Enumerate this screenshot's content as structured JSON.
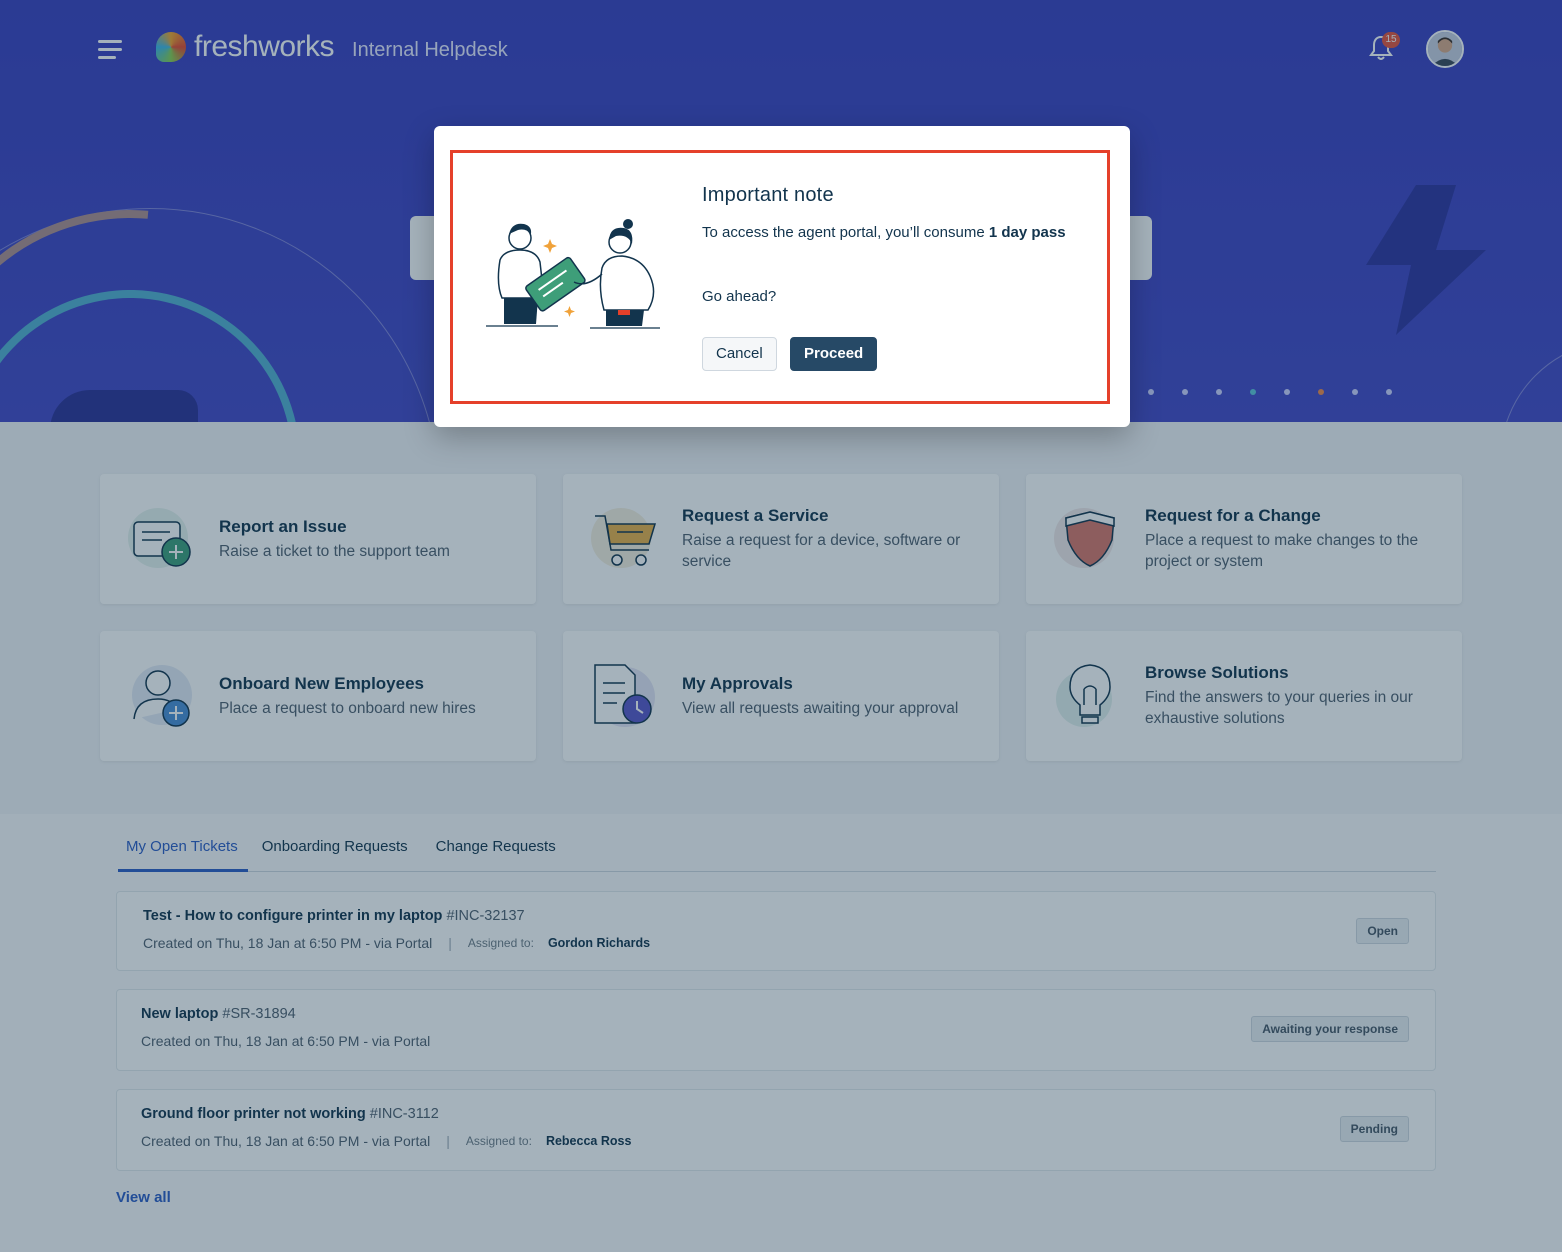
{
  "header": {
    "logo_text": "freshworks",
    "portal_name": "Internal Helpdesk",
    "notification_count": "15"
  },
  "cards": [
    {
      "title": "Report an Issue",
      "desc": "Raise a ticket to the support team",
      "icon": "ticket-plus-icon"
    },
    {
      "title": "Request a Service",
      "desc": "Raise a request for a device, software or service",
      "icon": "shopping-cart-icon"
    },
    {
      "title": "Request for a Change",
      "desc": "Place a request to make changes to the project or system",
      "icon": "shield-icon"
    },
    {
      "title": "Onboard New Employees",
      "desc": "Place a request to onboard new hires",
      "icon": "user-plus-icon"
    },
    {
      "title": "My Approvals",
      "desc": "View all requests awaiting your approval",
      "icon": "document-clock-icon"
    },
    {
      "title": "Browse Solutions",
      "desc": "Find the answers to your queries in our exhaustive solutions",
      "icon": "lightbulb-icon"
    }
  ],
  "tabs": [
    {
      "label": "My Open Tickets",
      "active": true
    },
    {
      "label": "Onboarding Requests",
      "active": false
    },
    {
      "label": "Change Requests",
      "active": false
    }
  ],
  "tickets": [
    {
      "title": "Test - How to configure printer in my laptop",
      "id": "#INC-32137",
      "created": "Created on Thu, 18 Jan at 6:50 PM - via Portal",
      "sep": "|",
      "assigned_label": "Assigned to:",
      "assignee": "Gordon Richards",
      "status": "Open"
    },
    {
      "title": "New laptop",
      "id": "#SR-31894",
      "created": "Created on Thu, 18 Jan at 6:50 PM - via Portal",
      "status": "Awaiting your response"
    },
    {
      "title": "Ground floor printer not working",
      "id": "#INC-3112",
      "created": "Created on Thu, 18 Jan at 6:50 PM - via Portal",
      "sep": "|",
      "assigned_label": "Assigned to:",
      "assignee": "Rebecca Ross",
      "status": "Pending"
    }
  ],
  "view_all": "View all",
  "modal": {
    "title": "Important note",
    "body_prefix": "To access the agent portal, you’ll consume ",
    "body_bold": "1 day pass",
    "question": "Go ahead?",
    "cancel_label": "Cancel",
    "proceed_label": "Proceed"
  },
  "colors": {
    "hero": "#3a3fbf",
    "accent": "#2c5cc5",
    "primary_button": "#264966",
    "highlight_border": "#e5402a"
  }
}
